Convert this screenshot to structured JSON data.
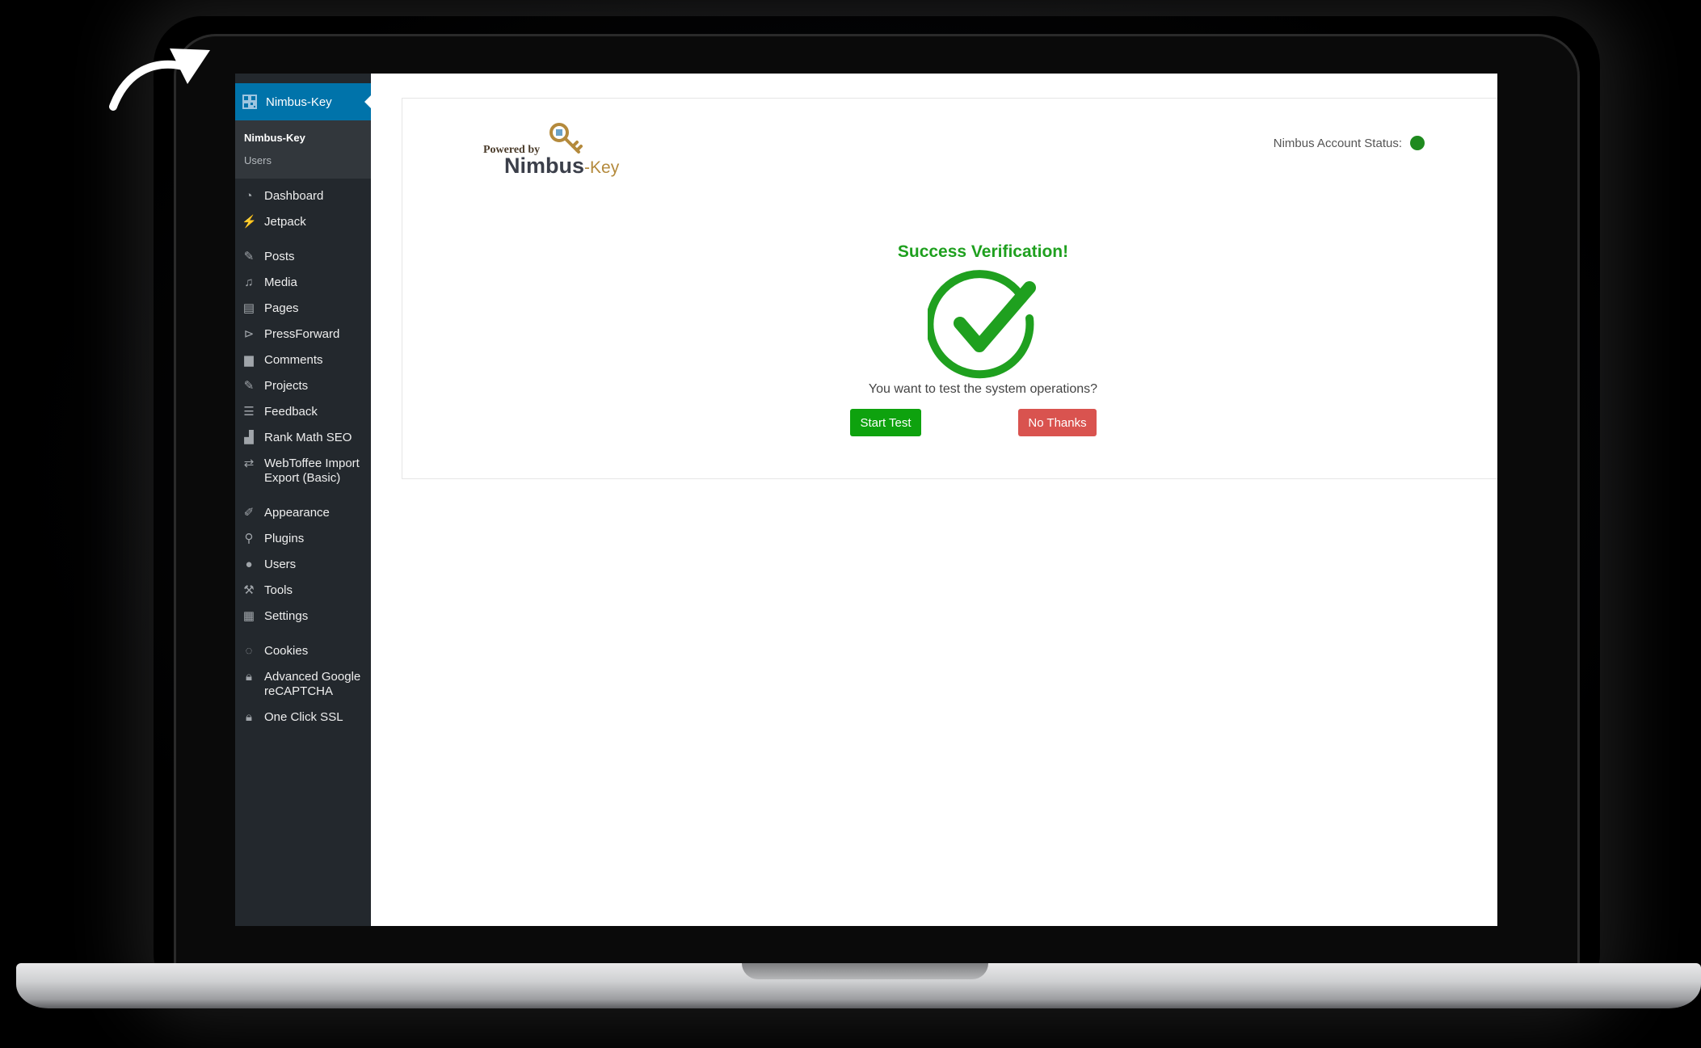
{
  "colors": {
    "sidebar_bg": "#23282d",
    "sidebar_active": "#0073aa",
    "success_green": "#1fa01f",
    "start_button": "#0ea20e",
    "no_thanks_button": "#d9534f",
    "status_dot": "#1e8a1e"
  },
  "sidebar": {
    "active_item": "Nimbus-Key",
    "submenu": [
      "Nimbus-Key",
      "Users"
    ],
    "items": [
      {
        "label": "Dashboard",
        "icon": "dashboard-icon"
      },
      {
        "label": "Jetpack",
        "icon": "jetpack-icon"
      },
      {
        "label": "Posts",
        "icon": "pushpin-icon"
      },
      {
        "label": "Media",
        "icon": "media-icon"
      },
      {
        "label": "Pages",
        "icon": "pages-icon"
      },
      {
        "label": "PressForward",
        "icon": "pressforward-icon"
      },
      {
        "label": "Comments",
        "icon": "comment-icon"
      },
      {
        "label": "Projects",
        "icon": "pushpin-icon"
      },
      {
        "label": "Feedback",
        "icon": "feedback-icon"
      },
      {
        "label": "Rank Math SEO",
        "icon": "chart-icon"
      },
      {
        "label": "WebToffee Import Export (Basic)",
        "icon": "import-export-icon"
      },
      {
        "label": "Appearance",
        "icon": "brush-icon"
      },
      {
        "label": "Plugins",
        "icon": "plugin-icon"
      },
      {
        "label": "Users",
        "icon": "user-icon"
      },
      {
        "label": "Tools",
        "icon": "wrench-icon"
      },
      {
        "label": "Settings",
        "icon": "settings-icon"
      },
      {
        "label": "Cookies",
        "icon": "cookie-icon"
      },
      {
        "label": "Advanced Google reCAPTCHA",
        "icon": "lock-icon"
      },
      {
        "label": "One Click SSL",
        "icon": "lock-icon"
      }
    ]
  },
  "brand": {
    "powered_by": "Powered by",
    "name_main": "Nimbus",
    "name_suffix": "-Key"
  },
  "status": {
    "label": "Nimbus Account Status:"
  },
  "verification": {
    "title": "Success Verification!",
    "question": "You want to test the system operations?",
    "start_button": "Start Test",
    "no_button": "No Thanks"
  }
}
